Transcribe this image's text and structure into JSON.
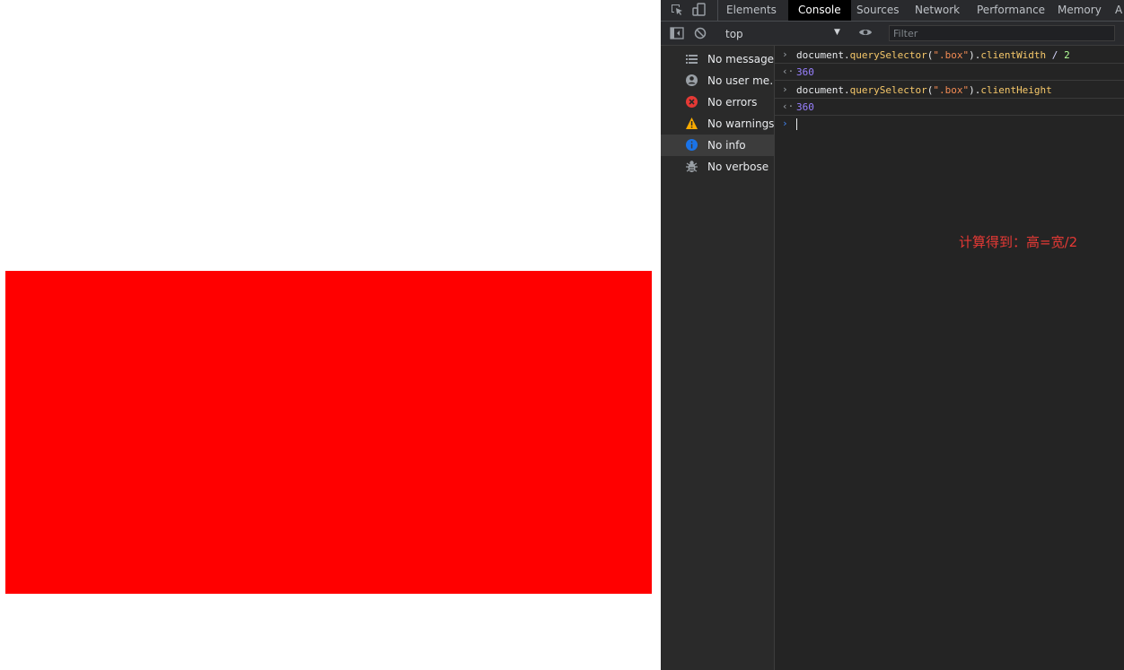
{
  "page": {
    "box_color": "#ff0000"
  },
  "devtools": {
    "tabs": [
      {
        "label": "Elements"
      },
      {
        "label": "Console"
      },
      {
        "label": "Sources"
      },
      {
        "label": "Network"
      },
      {
        "label": "Performance"
      },
      {
        "label": "Memory"
      },
      {
        "label": "A"
      }
    ],
    "active_tab": "Console",
    "toolbar": {
      "context": "top",
      "filter_placeholder": "Filter"
    },
    "sidebar": [
      {
        "label": "No messages",
        "icon": "list-icon"
      },
      {
        "label": "No user me…",
        "icon": "user-icon"
      },
      {
        "label": "No errors",
        "icon": "error-icon",
        "color": "#e53935"
      },
      {
        "label": "No warnings",
        "icon": "warning-icon",
        "color": "#f9ab00"
      },
      {
        "label": "No info",
        "icon": "info-icon",
        "color": "#1a73e8"
      },
      {
        "label": "No verbose",
        "icon": "bug-icon"
      }
    ],
    "console": {
      "entries": [
        {
          "obj": "document",
          "dot1": ".",
          "method": "querySelector",
          "paren_open": "(",
          "arg": "\".box\"",
          "paren_close": ")",
          "dot2": ".",
          "prop": "clientWidth",
          "op": " / ",
          "num": "2",
          "result": "360"
        },
        {
          "obj": "document",
          "dot1": ".",
          "method": "querySelector",
          "paren_open": "(",
          "arg": "\".box\"",
          "paren_close": ")",
          "dot2": ".",
          "prop": "clientHeight",
          "result": "360"
        }
      ],
      "input_caret": "›",
      "result_caret": "‹·",
      "prompt_caret": "›"
    },
    "annotation": "计算得到：高=宽/2"
  }
}
